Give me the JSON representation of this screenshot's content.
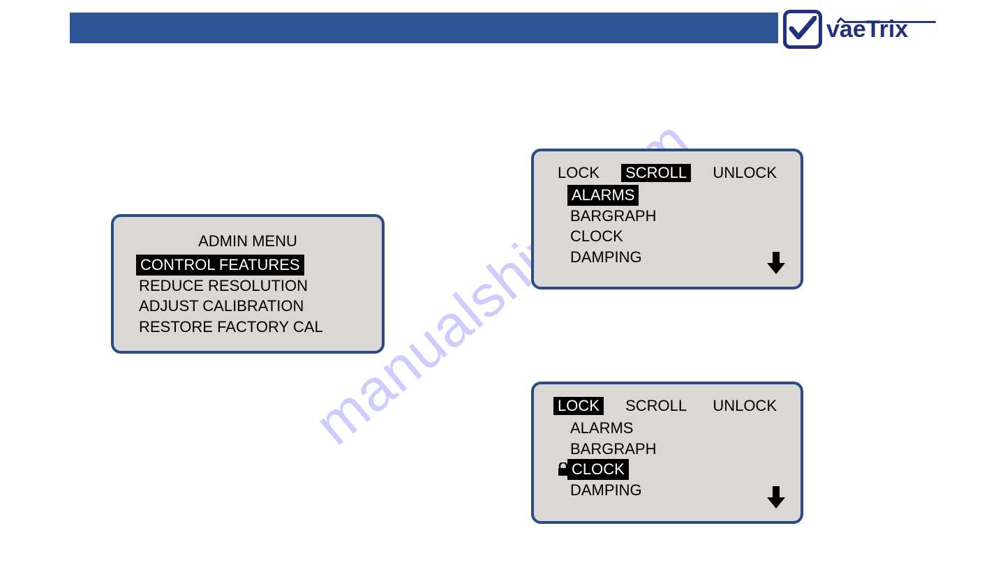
{
  "brand": {
    "name": "vaeTrix"
  },
  "watermark": "manualshive.com",
  "panel_admin": {
    "title": "ADMIN MENU",
    "items": [
      {
        "label": "CONTROL FEATURES",
        "selected": true
      },
      {
        "label": "REDUCE RESOLUTION",
        "selected": false
      },
      {
        "label": "ADJUST CALIBRATION",
        "selected": false
      },
      {
        "label": "RESTORE FACTORY CAL",
        "selected": false
      }
    ]
  },
  "panel_scroll": {
    "top": {
      "lock": {
        "label": "LOCK",
        "selected": false
      },
      "scroll": {
        "label": "SCROLL",
        "selected": true
      },
      "unlock": {
        "label": "UNLOCK",
        "selected": false
      }
    },
    "items": [
      {
        "label": "ALARMS",
        "selected": true,
        "locked": false
      },
      {
        "label": "BARGRAPH",
        "selected": false,
        "locked": false
      },
      {
        "label": "CLOCK",
        "selected": false,
        "locked": false
      },
      {
        "label": "DAMPING",
        "selected": false,
        "locked": false
      }
    ]
  },
  "panel_lock": {
    "top": {
      "lock": {
        "label": "LOCK",
        "selected": true
      },
      "scroll": {
        "label": "SCROLL",
        "selected": false
      },
      "unlock": {
        "label": "UNLOCK",
        "selected": false
      }
    },
    "items": [
      {
        "label": "ALARMS",
        "selected": false,
        "locked": false
      },
      {
        "label": "BARGRAPH",
        "selected": false,
        "locked": false
      },
      {
        "label": "CLOCK",
        "selected": true,
        "locked": true
      },
      {
        "label": "DAMPING",
        "selected": false,
        "locked": false
      }
    ]
  }
}
